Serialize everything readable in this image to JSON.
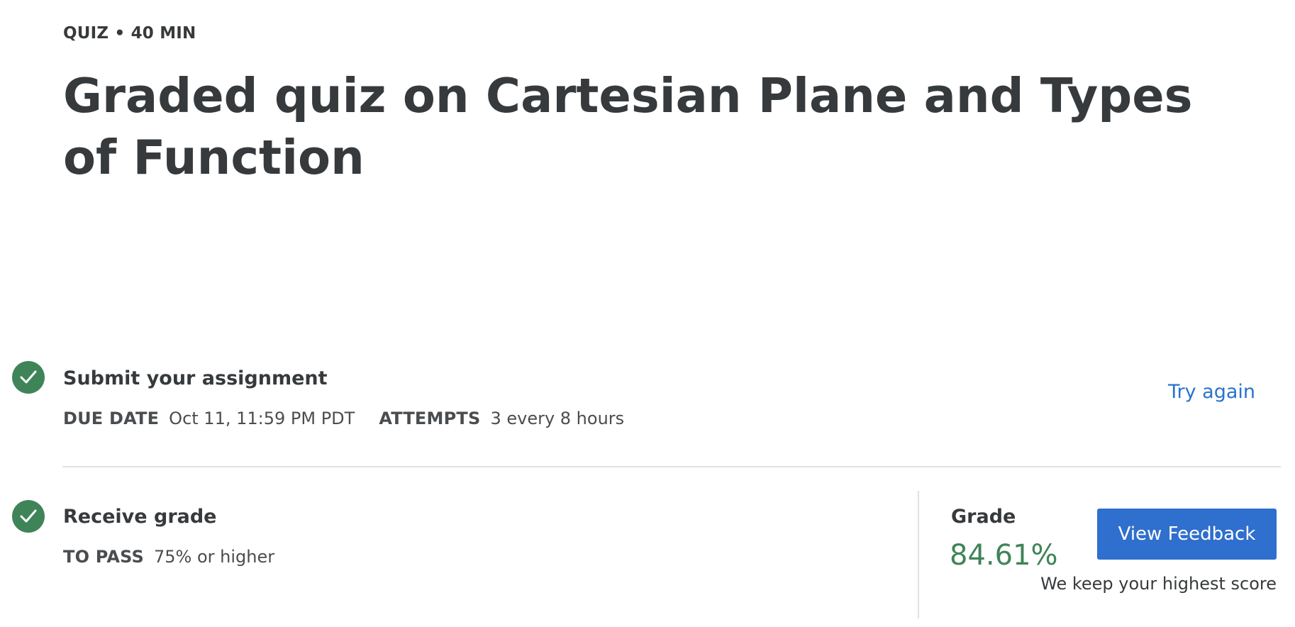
{
  "header": {
    "eyebrow": "QUIZ • 40 MIN",
    "title": "Graded quiz on Cartesian Plane and Types of Function"
  },
  "submit_step": {
    "title": "Submit your assignment",
    "due_label": "DUE DATE",
    "due_value": "Oct 11, 11:59 PM PDT",
    "attempts_label": "ATTEMPTS",
    "attempts_value": "3 every 8 hours",
    "action_label": "Try again",
    "status_icon": "check-circle-icon"
  },
  "grade_step": {
    "title": "Receive grade",
    "pass_label": "TO PASS",
    "pass_value": "75% or higher",
    "status_icon": "check-circle-icon"
  },
  "grade_panel": {
    "label": "Grade",
    "value": "84.61%",
    "button_label": "View Feedback",
    "note": "We keep your highest score"
  },
  "colors": {
    "success_green": "#3f8458",
    "link_blue": "#2a73cc",
    "button_blue": "#2f6fcd",
    "text_dark": "#373a3c"
  }
}
